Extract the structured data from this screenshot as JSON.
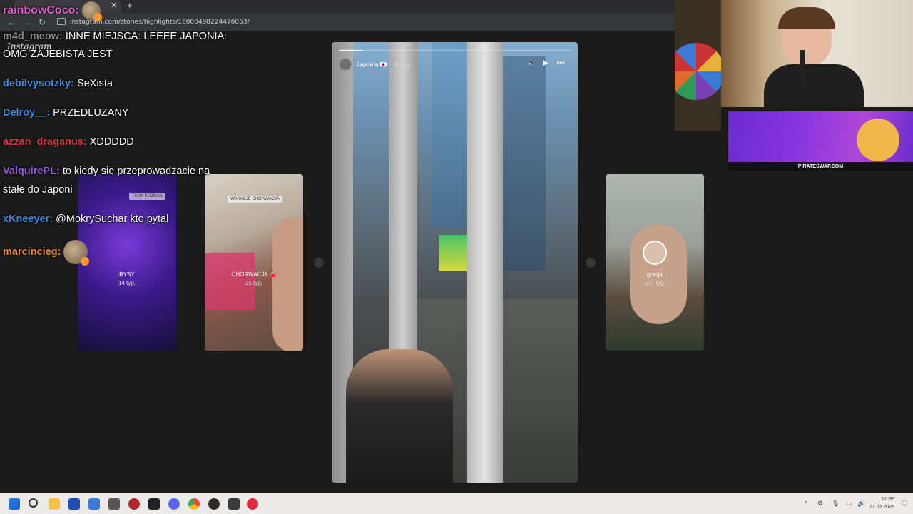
{
  "browser": {
    "url": "instagram.com/stories/highlights/18000498224476053/",
    "new_tab_label": "+",
    "close_tab_label": "✕"
  },
  "instagram": {
    "logo": "Instagram",
    "main_story": {
      "user": "Japonia 🇯🇵",
      "time": "80 tyg.",
      "progress": 0.1
    },
    "side_stories": [
      {
        "name": "RYSY",
        "time": "14 tyg.",
        "tag": "TAMA POZNAŃ"
      },
      {
        "name": "CHORWACJA 🚘",
        "time": "25 tyg.",
        "tag": "WAKACJE CHORWACJA"
      },
      {
        "name": "grecja",
        "time": "177 tyg."
      }
    ]
  },
  "chat": [
    {
      "user": "rainbowCoco:",
      "color": "#e35fd0",
      "text": ""
    },
    {
      "user": "m4d_meow:",
      "color": "#888888",
      "text": "INNE MIEJSCA: LEEEE JAPONIA:"
    },
    {
      "user": "",
      "color": "#ffffff",
      "text": "OMG ZAJEBISTA JEST"
    },
    {
      "user": "debilvysotzky:",
      "color": "#3d8be0",
      "text": "SeXista"
    },
    {
      "user": "Delroy__:",
      "color": "#3d8be0",
      "text": "PRZEDLUZANY"
    },
    {
      "user": "azzan_draganus:",
      "color": "#d23a3a",
      "text": "XDDDDD"
    },
    {
      "user": "ValquirePL:",
      "color": "#9a5ee0",
      "text": "to kiedy sie przeprowadzacie na"
    },
    {
      "user": "",
      "color": "#ffffff",
      "text": "stałe do Japoni"
    },
    {
      "user": "xKneeyer:",
      "color": "#3d8be0",
      "text": "@MokrySuchar kto pytal"
    },
    {
      "user": "marcincieg:",
      "color": "#e0832a",
      "text": ""
    }
  ],
  "ad": {
    "text": "PIRATESWAP.COM"
  },
  "taskbar": {
    "time": "00:35",
    "date": "22.02.2026"
  }
}
